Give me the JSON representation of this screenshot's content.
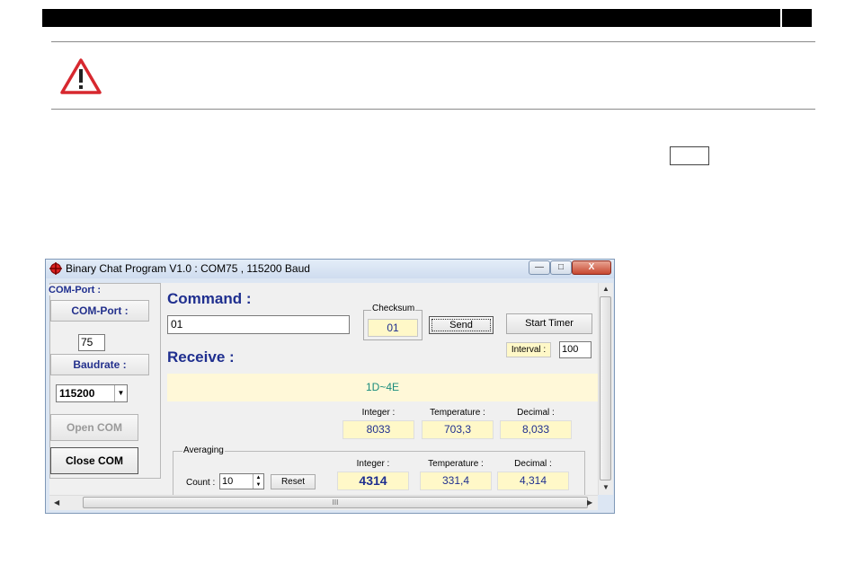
{
  "window": {
    "title": "Binary Chat Program V1.0 : COM75 , 115200 Baud",
    "controls": {
      "minimize": "—",
      "maximize": "□",
      "close": "X"
    }
  },
  "left_panel": {
    "title": "COM-Port :",
    "comport_label": "COM-Port :",
    "comport_value": "75",
    "baudrate_label": "Baudrate :",
    "baudrate_value": "115200",
    "open_button": "Open COM",
    "close_button": "Close COM"
  },
  "command": {
    "label": "Command :",
    "value": "01",
    "checksum_label": "Checksum",
    "checksum_value": "01",
    "send_button": "Send",
    "start_timer_button": "Start Timer",
    "interval_label": "Interval :",
    "interval_value": "100"
  },
  "receive": {
    "label": "Receive :",
    "value": "1D~4E",
    "integer_label": "Integer :",
    "integer_value": "8033",
    "temperature_label": "Temperature :",
    "temperature_value": "703,3",
    "decimal_label": "Decimal :",
    "decimal_value": "8,033"
  },
  "averaging": {
    "title": "Averaging",
    "count_label": "Count :",
    "count_value": "10",
    "reset_button": "Reset",
    "integer_label": "Integer :",
    "integer_value": "4314",
    "temperature_label": "Temperature :",
    "temperature_value": "331,4",
    "decimal_label": "Decimal :",
    "decimal_value": "4,314"
  },
  "scrollbar": {
    "grip": "III",
    "icon": "grip-icon"
  },
  "colors": {
    "accent": "#1f2f8f",
    "highlight": "#fff8c8",
    "warning": "#d7282f"
  }
}
